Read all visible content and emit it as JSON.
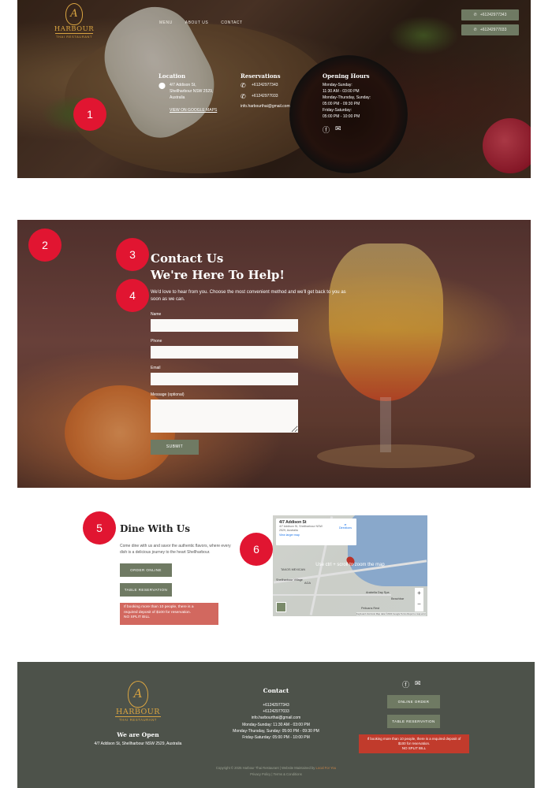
{
  "brand": {
    "name": "HARBOUR",
    "subtitle": "THAI RESTAURANT",
    "monogram": "A",
    "gold": "#d9a441"
  },
  "colors": {
    "accent_green": "#6f7a63",
    "alert_red": "#c13b2c",
    "marker_red": "#e11531",
    "footer_bg": "#4d524a"
  },
  "nav": {
    "items": [
      "MENU",
      "ABOUT US",
      "CONTACT"
    ]
  },
  "top_phones": [
    "+61242977343",
    "+61242977033"
  ],
  "hero_info": {
    "location": {
      "heading": "Location",
      "address": [
        "4/7 Addison St,",
        "Shellharbour NSW 2529,",
        "Australia"
      ],
      "map_link": "VIEW ON GOOGLE MAPS",
      "icon": "map-pin-icon"
    },
    "reservations": {
      "heading": "Reservations",
      "phones": [
        "+61242977343",
        "+61242977033"
      ],
      "email": "info.harbourthai@gmail.com",
      "icon": "phone-icon"
    },
    "hours": {
      "heading": "Opening Hours",
      "lines": [
        "Monday-Sunday:",
        "11:30 AM - 03:00 PM",
        "Monday-Thursday, Sunday:",
        "05:00 PM - 09:30 PM",
        "Friday-Saturday:",
        "05:00 PM - 10:00 PM"
      ]
    },
    "social": [
      "facebook-icon",
      "email-icon"
    ]
  },
  "markers": [
    "1",
    "2",
    "3",
    "4",
    "5",
    "6"
  ],
  "contact": {
    "title_line1": "Contact Us",
    "title_line2": "We're Here To Help!",
    "description": "We'd love to hear from you. Choose the most convenient method and we'll get back to you as soon as we can.",
    "fields": [
      {
        "label": "Name",
        "value": ""
      },
      {
        "label": "Phone",
        "value": ""
      },
      {
        "label": "Email",
        "value": ""
      },
      {
        "label": "Message (optional)",
        "value": ""
      }
    ],
    "submit": "SUBMIT"
  },
  "dine": {
    "title": "Dine With Us",
    "description": "Come dine with us and savor the authentic flavors, where every dish is a delicious journey to the heart Shellharbour.",
    "order_btn": "ORDER ONLINE",
    "reserve_btn": "TABLE RESERVATION",
    "notice": [
      "If booking more than 10 people, there is a",
      "required deposit of $100 for reservation.",
      "NO SPLIT BILL"
    ]
  },
  "map": {
    "place": "4/7 Addison St",
    "address": [
      "4/7 Addison St, Shellharbour NSW",
      "2529, Australia"
    ],
    "view_larger": "View larger map",
    "directions": "Directions",
    "hint": "Use ctrl + scroll to zoom the map",
    "zoom_in": "+",
    "zoom_out": "−",
    "labels": [
      "TAKOS MEXICAN",
      "Shellharbour Village",
      "AGA",
      "Arabella Day Spa",
      "Pelicans Rest",
      "Beachbar"
    ],
    "footer_text": "Keyboard shortcuts  Map data ©2024 Google  Terms  Report a map error"
  },
  "footer": {
    "open_heading": "We are Open",
    "address": "4/7 Addison St, Shellharbour NSW 2529, Australia",
    "contact_heading": "Contact",
    "contact_lines": [
      "+61242977343",
      "+61242977033",
      "info.harbourthai@gmail.com",
      "Monday-Sunday: 11:30 AM - 03:00 PM",
      "Monday-Thursday, Sunday: 05:00 PM - 09:30 PM",
      "Friday-Saturday: 05:00 PM - 10:00 PM"
    ],
    "online_order": "ONLINE ORDER",
    "table_reservation": "TABLE RESERVATION",
    "notice": [
      "If booking more than 10 people, there is a required deposit of",
      "$100 for reservation.",
      "NO SPLIT BILL"
    ],
    "copyright": "Copyright © 2025 Harbour Thai Restaurant | Website Maintained by",
    "maintainer": "Local For You",
    "legal": "Privacy Policy  |  Terms & Conditions"
  }
}
